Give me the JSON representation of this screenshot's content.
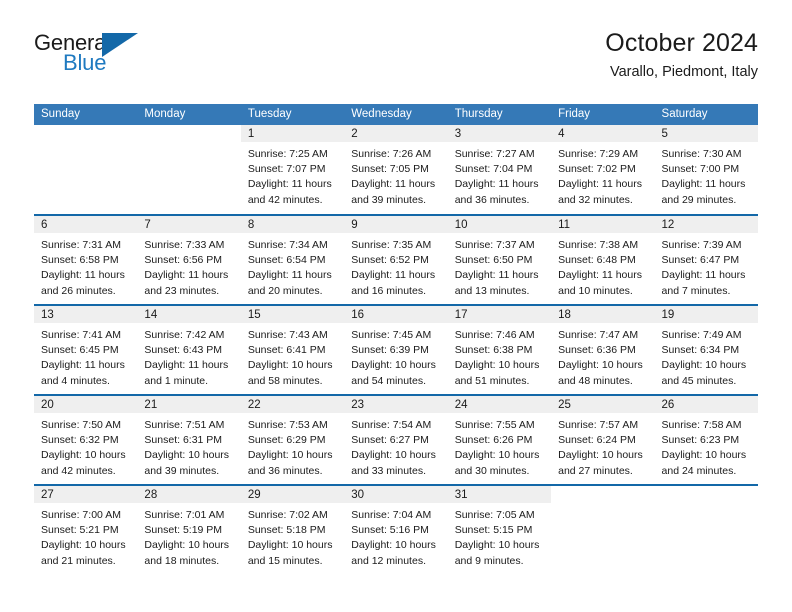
{
  "brand": {
    "name_part1": "General",
    "name_part2": "Blue",
    "logo_icon": "triangle-logo-icon"
  },
  "header": {
    "month_title": "October 2024",
    "location": "Varallo, Piedmont, Italy"
  },
  "colors": {
    "header_blue": "#3579b7",
    "rule_blue": "#1368a8",
    "daynum_band": "#efefef",
    "brand_blue": "#1f7ac0",
    "text": "#1b1b1b"
  },
  "calendar": {
    "weekday_headers": [
      "Sunday",
      "Monday",
      "Tuesday",
      "Wednesday",
      "Thursday",
      "Friday",
      "Saturday"
    ],
    "weeks": [
      [
        {
          "day": "",
          "blank": true,
          "lines": []
        },
        {
          "day": "",
          "blank": true,
          "lines": []
        },
        {
          "day": "1",
          "lines": [
            "Sunrise: 7:25 AM",
            "Sunset: 7:07 PM",
            "Daylight: 11 hours",
            "and 42 minutes."
          ]
        },
        {
          "day": "2",
          "lines": [
            "Sunrise: 7:26 AM",
            "Sunset: 7:05 PM",
            "Daylight: 11 hours",
            "and 39 minutes."
          ]
        },
        {
          "day": "3",
          "lines": [
            "Sunrise: 7:27 AM",
            "Sunset: 7:04 PM",
            "Daylight: 11 hours",
            "and 36 minutes."
          ]
        },
        {
          "day": "4",
          "lines": [
            "Sunrise: 7:29 AM",
            "Sunset: 7:02 PM",
            "Daylight: 11 hours",
            "and 32 minutes."
          ]
        },
        {
          "day": "5",
          "lines": [
            "Sunrise: 7:30 AM",
            "Sunset: 7:00 PM",
            "Daylight: 11 hours",
            "and 29 minutes."
          ]
        }
      ],
      [
        {
          "day": "6",
          "lines": [
            "Sunrise: 7:31 AM",
            "Sunset: 6:58 PM",
            "Daylight: 11 hours",
            "and 26 minutes."
          ]
        },
        {
          "day": "7",
          "lines": [
            "Sunrise: 7:33 AM",
            "Sunset: 6:56 PM",
            "Daylight: 11 hours",
            "and 23 minutes."
          ]
        },
        {
          "day": "8",
          "lines": [
            "Sunrise: 7:34 AM",
            "Sunset: 6:54 PM",
            "Daylight: 11 hours",
            "and 20 minutes."
          ]
        },
        {
          "day": "9",
          "lines": [
            "Sunrise: 7:35 AM",
            "Sunset: 6:52 PM",
            "Daylight: 11 hours",
            "and 16 minutes."
          ]
        },
        {
          "day": "10",
          "lines": [
            "Sunrise: 7:37 AM",
            "Sunset: 6:50 PM",
            "Daylight: 11 hours",
            "and 13 minutes."
          ]
        },
        {
          "day": "11",
          "lines": [
            "Sunrise: 7:38 AM",
            "Sunset: 6:48 PM",
            "Daylight: 11 hours",
            "and 10 minutes."
          ]
        },
        {
          "day": "12",
          "lines": [
            "Sunrise: 7:39 AM",
            "Sunset: 6:47 PM",
            "Daylight: 11 hours",
            "and 7 minutes."
          ]
        }
      ],
      [
        {
          "day": "13",
          "lines": [
            "Sunrise: 7:41 AM",
            "Sunset: 6:45 PM",
            "Daylight: 11 hours",
            "and 4 minutes."
          ]
        },
        {
          "day": "14",
          "lines": [
            "Sunrise: 7:42 AM",
            "Sunset: 6:43 PM",
            "Daylight: 11 hours",
            "and 1 minute."
          ]
        },
        {
          "day": "15",
          "lines": [
            "Sunrise: 7:43 AM",
            "Sunset: 6:41 PM",
            "Daylight: 10 hours",
            "and 58 minutes."
          ]
        },
        {
          "day": "16",
          "lines": [
            "Sunrise: 7:45 AM",
            "Sunset: 6:39 PM",
            "Daylight: 10 hours",
            "and 54 minutes."
          ]
        },
        {
          "day": "17",
          "lines": [
            "Sunrise: 7:46 AM",
            "Sunset: 6:38 PM",
            "Daylight: 10 hours",
            "and 51 minutes."
          ]
        },
        {
          "day": "18",
          "lines": [
            "Sunrise: 7:47 AM",
            "Sunset: 6:36 PM",
            "Daylight: 10 hours",
            "and 48 minutes."
          ]
        },
        {
          "day": "19",
          "lines": [
            "Sunrise: 7:49 AM",
            "Sunset: 6:34 PM",
            "Daylight: 10 hours",
            "and 45 minutes."
          ]
        }
      ],
      [
        {
          "day": "20",
          "lines": [
            "Sunrise: 7:50 AM",
            "Sunset: 6:32 PM",
            "Daylight: 10 hours",
            "and 42 minutes."
          ]
        },
        {
          "day": "21",
          "lines": [
            "Sunrise: 7:51 AM",
            "Sunset: 6:31 PM",
            "Daylight: 10 hours",
            "and 39 minutes."
          ]
        },
        {
          "day": "22",
          "lines": [
            "Sunrise: 7:53 AM",
            "Sunset: 6:29 PM",
            "Daylight: 10 hours",
            "and 36 minutes."
          ]
        },
        {
          "day": "23",
          "lines": [
            "Sunrise: 7:54 AM",
            "Sunset: 6:27 PM",
            "Daylight: 10 hours",
            "and 33 minutes."
          ]
        },
        {
          "day": "24",
          "lines": [
            "Sunrise: 7:55 AM",
            "Sunset: 6:26 PM",
            "Daylight: 10 hours",
            "and 30 minutes."
          ]
        },
        {
          "day": "25",
          "lines": [
            "Sunrise: 7:57 AM",
            "Sunset: 6:24 PM",
            "Daylight: 10 hours",
            "and 27 minutes."
          ]
        },
        {
          "day": "26",
          "lines": [
            "Sunrise: 7:58 AM",
            "Sunset: 6:23 PM",
            "Daylight: 10 hours",
            "and 24 minutes."
          ]
        }
      ],
      [
        {
          "day": "27",
          "lines": [
            "Sunrise: 7:00 AM",
            "Sunset: 5:21 PM",
            "Daylight: 10 hours",
            "and 21 minutes."
          ]
        },
        {
          "day": "28",
          "lines": [
            "Sunrise: 7:01 AM",
            "Sunset: 5:19 PM",
            "Daylight: 10 hours",
            "and 18 minutes."
          ]
        },
        {
          "day": "29",
          "lines": [
            "Sunrise: 7:02 AM",
            "Sunset: 5:18 PM",
            "Daylight: 10 hours",
            "and 15 minutes."
          ]
        },
        {
          "day": "30",
          "lines": [
            "Sunrise: 7:04 AM",
            "Sunset: 5:16 PM",
            "Daylight: 10 hours",
            "and 12 minutes."
          ]
        },
        {
          "day": "31",
          "lines": [
            "Sunrise: 7:05 AM",
            "Sunset: 5:15 PM",
            "Daylight: 10 hours",
            "and 9 minutes."
          ]
        },
        {
          "day": "",
          "blank": true,
          "lines": []
        },
        {
          "day": "",
          "blank": true,
          "lines": []
        }
      ]
    ]
  }
}
